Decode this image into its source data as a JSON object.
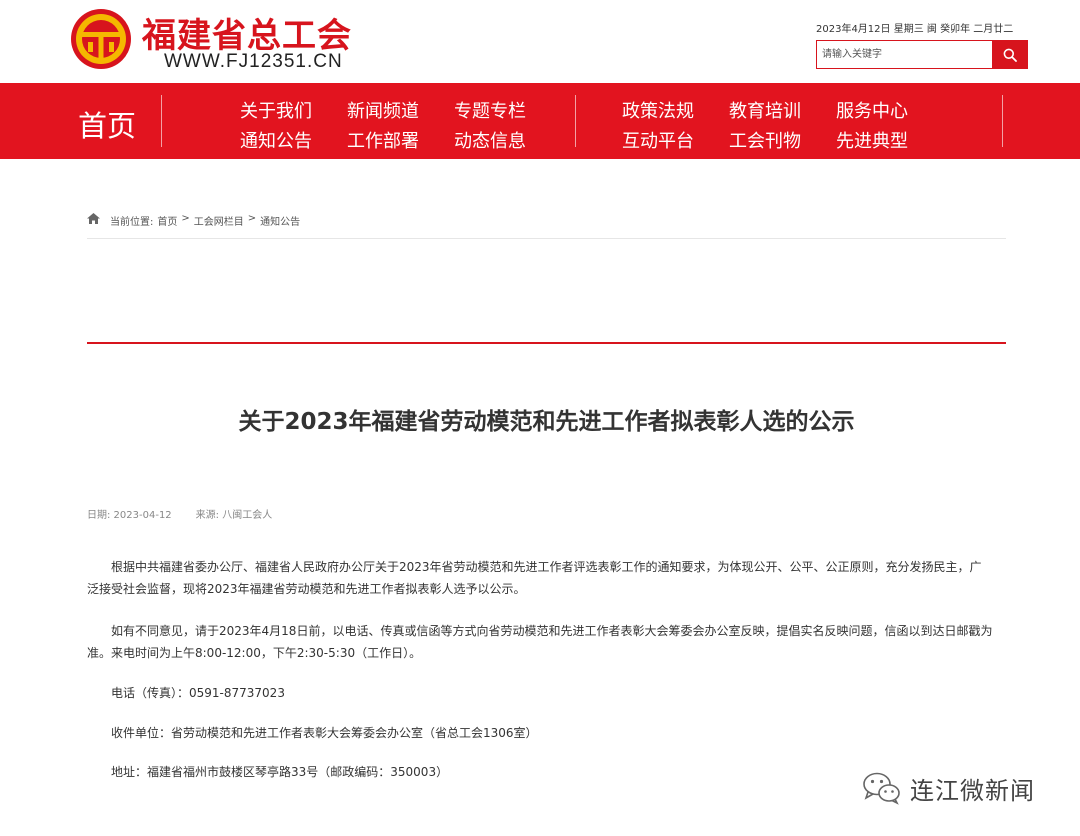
{
  "header": {
    "site_title": "福建省总工会",
    "site_url": "WWW.FJ12351.CN",
    "date_line": "2023年4月12日 星期三 闽 癸卯年 二月廿二",
    "search": {
      "placeholder": "请输入关键字"
    },
    "brand_color": "#d7141d"
  },
  "nav": {
    "home": "首页",
    "group1": [
      "关于我们",
      "新闻频道",
      "专题专栏",
      "通知公告",
      "工作部署",
      "动态信息"
    ],
    "group2": [
      "政策法规",
      "教育培训",
      "服务中心",
      "互动平台",
      "工会刊物",
      "先进典型"
    ],
    "background": "#e2141f"
  },
  "breadcrumb": {
    "prefix": "当前位置:",
    "items": [
      "首页",
      "工会网栏目",
      "通知公告"
    ],
    "separator": ">"
  },
  "article": {
    "title": "关于2023年福建省劳动模范和先进工作者拟表彰人选的公示",
    "date_label": "日期: 2023-04-12",
    "source_label": "来源: 八闽工会人",
    "paragraph1_line1": "根据中共福建省委办公厅、福建省人民政府办公厅关于2023年省劳动模范和先进工作者评选表彰工作的通知要求，为体现公开、公平、公正原则，充分发扬民主，广",
    "paragraph1_line2": "泛接受社会监督，现将2023年福建省劳动模范和先进工作者拟表彰人选予以公示。",
    "paragraph2_line1": "如有不同意见，请于2023年4月18日前，以电话、传真或信函等方式向省劳动模范和先进工作者表彰大会筹委会办公室反映，提倡实名反映问题，信函以到达日邮戳为",
    "paragraph2_line2": "准。来电时间为上午8:00-12:00，下午2:30-5:30（工作日）。",
    "phone": "电话（传真）：0591-87737023",
    "recipient": "收件单位：省劳动模范和先进工作者表彰大会筹委会办公室（省总工会1306室）",
    "address": "地址：福建省福州市鼓楼区琴亭路33号（邮政编码：350003）"
  },
  "watermark": {
    "text": "连江微新闻",
    "icon": "wechat-icon"
  }
}
